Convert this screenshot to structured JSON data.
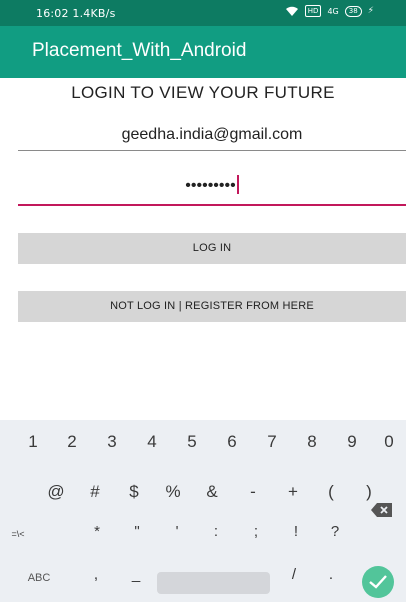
{
  "status": {
    "time": "16:02",
    "speed": "1.4KB/s",
    "sim_label": "HD",
    "signal_label": "4G",
    "battery": "38",
    "bolt": "⚡"
  },
  "appbar": {
    "title": "Placement_With_Android"
  },
  "form": {
    "heading": "LOGIN TO VIEW YOUR FUTURE",
    "email_value": "geedha.india@gmail.com",
    "password_value": "•••••••••",
    "login_label": "LOG IN",
    "register_label": "NOT LOG IN | REGISTER FROM HERE"
  },
  "keyboard": {
    "row1": [
      "1",
      "2",
      "3",
      "4",
      "5",
      "6",
      "7",
      "8",
      "9",
      "0"
    ],
    "row2": [
      "@",
      "#",
      "$",
      "%",
      "&",
      "-",
      "+",
      "(",
      ")"
    ],
    "row3": [
      "=\\<",
      "*",
      "\"",
      "'",
      ":",
      ";",
      "!",
      "?"
    ],
    "row4": {
      "abc": "ABC",
      "comma": ",",
      "underscore": "_",
      "slash": "/",
      "period": "."
    }
  },
  "colors": {
    "appbar": "#119d82",
    "statusbar": "#0d7b62",
    "accent": "#c2185b",
    "enter": "#52c59a"
  }
}
